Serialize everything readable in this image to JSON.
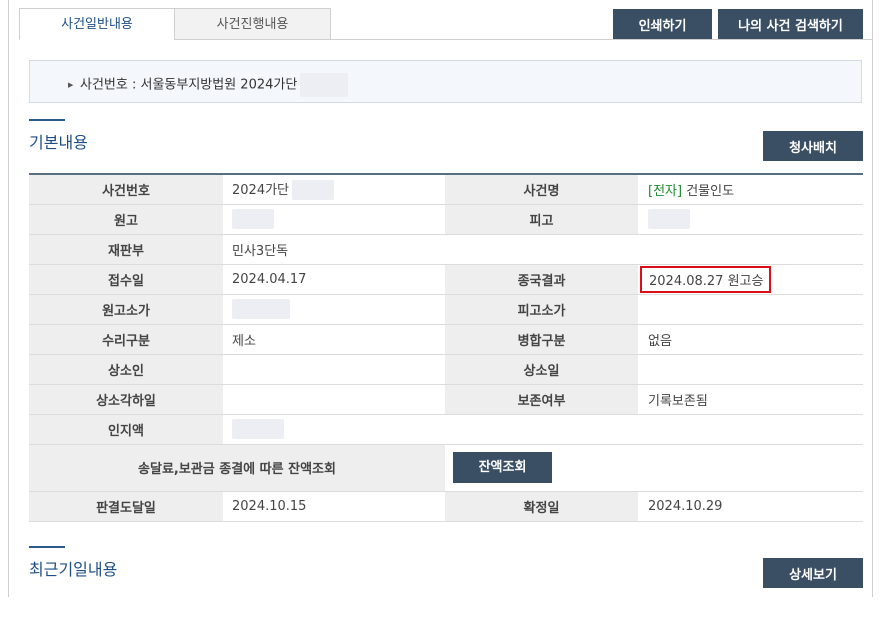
{
  "tabs": [
    {
      "label": "사건일반내용",
      "active": true
    },
    {
      "label": "사건진행내용",
      "active": false
    }
  ],
  "toolbar": {
    "print_label": "인쇄하기",
    "search_label": "나의 사건 검색하기"
  },
  "case_header": {
    "text": "사건번호 : 서울동부지방법원 2024가단"
  },
  "sections": {
    "basic": {
      "title": "기본내용",
      "button_label": "청사배치"
    },
    "recent": {
      "title": "최근기일내용",
      "button_label": "상세보기"
    }
  },
  "info": {
    "case_number": {
      "label": "사건번호",
      "value": "2024가단"
    },
    "case_name": {
      "label": "사건명",
      "prefix": "[전자]",
      "value": "건물인도"
    },
    "plaintiff": {
      "label": "원고"
    },
    "defendant": {
      "label": "피고"
    },
    "court_division": {
      "label": "재판부",
      "value": "민사3단독"
    },
    "filing_date": {
      "label": "접수일",
      "value": "2024.04.17"
    },
    "final_result": {
      "label": "종국결과",
      "value": "2024.08.27 원고승"
    },
    "plaintiff_claim": {
      "label": "원고소가"
    },
    "defendant_claim": {
      "label": "피고소가"
    },
    "acceptance_type": {
      "label": "수리구분",
      "value": "제소"
    },
    "merger_type": {
      "label": "병합구분",
      "value": "없음"
    },
    "appellant": {
      "label": "상소인"
    },
    "appeal_date": {
      "label": "상소일"
    },
    "appeal_dismissal_date": {
      "label": "상소각하일"
    },
    "preservation": {
      "label": "보존여부",
      "value": "기록보존됨"
    },
    "stamp_amount": {
      "label": "인지액"
    },
    "balance_inquiry": {
      "label": "송달료,보관금 종결에 따른 잔액조회",
      "button_label": "잔액조회"
    },
    "judgment_delivery_date": {
      "label": "판결도달일",
      "value": "2024.10.15"
    },
    "confirmation_date": {
      "label": "확정일",
      "value": "2024.10.29"
    }
  },
  "colors": {
    "accent": "#1f4e86",
    "button": "#3a4f63",
    "highlight": "#d9101a",
    "electronic": "#1d8a2f"
  }
}
